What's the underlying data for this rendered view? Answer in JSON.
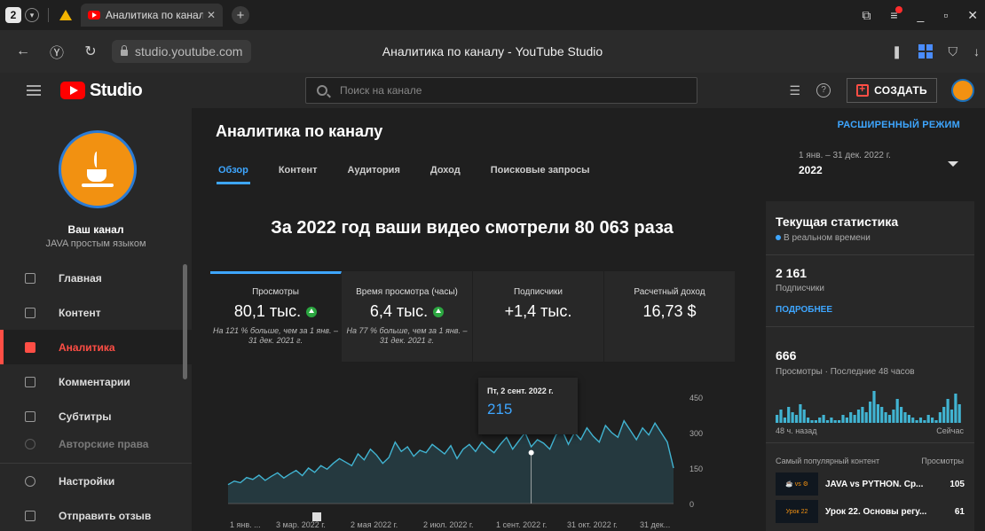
{
  "browser": {
    "tab_count": "2",
    "tab_title": "Аналитика по каналу -",
    "url": "studio.youtube.com",
    "page_title": "Аналитика по каналу - YouTube Studio"
  },
  "header": {
    "logo_text": "Studio",
    "search_placeholder": "Поиск на канале",
    "create_label": "СОЗДАТЬ"
  },
  "sidebar": {
    "channel_name": "Ваш канал",
    "channel_subtitle": "JAVA простым языком",
    "items": [
      {
        "label": "Главная"
      },
      {
        "label": "Контент"
      },
      {
        "label": "Аналитика"
      },
      {
        "label": "Комментарии"
      },
      {
        "label": "Субтитры"
      },
      {
        "label": "Авторские права"
      }
    ],
    "bottom_items": [
      {
        "label": "Настройки"
      },
      {
        "label": "Отправить отзыв"
      }
    ]
  },
  "main": {
    "title": "Аналитика по каналу",
    "tabs": [
      {
        "label": "Обзор"
      },
      {
        "label": "Контент"
      },
      {
        "label": "Аудитория"
      },
      {
        "label": "Доход"
      },
      {
        "label": "Поисковые запросы"
      }
    ],
    "headline": "За 2022 год ваши видео смотрели 80 063 раза",
    "cards": [
      {
        "label": "Просмотры",
        "value": "80,1 тыс.",
        "note": "На 121 % больше, чем за 1 янв. – 31 дек. 2021 г."
      },
      {
        "label": "Время просмотра (часы)",
        "value": "6,4 тыс.",
        "note": "На 77 % больше, чем за 1 янв. – 31 дек. 2021 г."
      },
      {
        "label": "Подписчики",
        "value": "+1,4 тыс.",
        "note": ""
      },
      {
        "label": "Расчетный доход",
        "value": "16,73 $",
        "note": ""
      }
    ],
    "tooltip": {
      "date": "Пт, 2 сент. 2022 г.",
      "value": "215"
    }
  },
  "right": {
    "advanced_mode": "РАСШИРЕННЫЙ РЕЖИМ",
    "date_range": "1 янв. – 31 дек. 2022 г.",
    "date_year": "2022",
    "realtime_title": "Текущая статистика",
    "realtime_label": "В реальном времени",
    "subscribers_value": "2 161",
    "subscribers_label": "Подписчики",
    "more_link": "ПОДРОБНЕЕ",
    "views_value": "666",
    "views_label": "Просмотры · Последние 48 часов",
    "bars_left": "48 ч. назад",
    "bars_right": "Сейчас",
    "top_content_label": "Самый популярный контент",
    "top_content_col": "Просмотры",
    "top_items": [
      {
        "title": "JAVA vs PYTHON. Ср...",
        "views": "105"
      },
      {
        "title": "Урок 22. Основы регу...",
        "views": "61"
      }
    ],
    "hourly_views": [
      3,
      5,
      2,
      6,
      4,
      3,
      7,
      5,
      2,
      1,
      1,
      2,
      3,
      1,
      2,
      1,
      1,
      3,
      2,
      4,
      3,
      5,
      6,
      4,
      8,
      12,
      7,
      6,
      4,
      3,
      5,
      9,
      6,
      4,
      3,
      2,
      1,
      2,
      1,
      3,
      2,
      1,
      4,
      6,
      9,
      5,
      11,
      7
    ]
  },
  "chart_data": {
    "type": "area",
    "x_ticks": [
      "1 янв. ...",
      "3 мар. 2022 г.",
      "2 мая 2022 г.",
      "2 июл. 2022 г.",
      "1 сент. 2022 г.",
      "31 окт. 2022 г.",
      "31 дек..."
    ],
    "y_ticks": [
      "0",
      "150",
      "300",
      "450"
    ],
    "ylim": [
      0,
      450
    ],
    "highlight": {
      "date": "Пт, 2 сент. 2022 г.",
      "value": 215
    },
    "values": [
      80,
      95,
      88,
      110,
      102,
      120,
      98,
      115,
      130,
      108,
      125,
      140,
      118,
      150,
      132,
      160,
      145,
      170,
      190,
      175,
      160,
      210,
      185,
      230,
      205,
      170,
      195,
      260,
      220,
      240,
      200,
      225,
      215,
      250,
      230,
      210,
      245,
      190,
      230,
      250,
      220,
      260,
      235,
      215,
      250,
      280,
      230,
      265,
      300,
      240,
      270,
      255,
      230,
      290,
      310,
      250,
      300,
      270,
      320,
      285,
      260,
      330,
      300,
      280,
      350,
      310,
      270,
      320,
      290,
      340,
      300,
      260,
      150
    ]
  },
  "colors": {
    "accent": "#3ea6ff",
    "brand_red": "#ff0000",
    "nav_active": "#ff4e45",
    "success": "#2ba640",
    "chart_line": "#41b4d2"
  }
}
